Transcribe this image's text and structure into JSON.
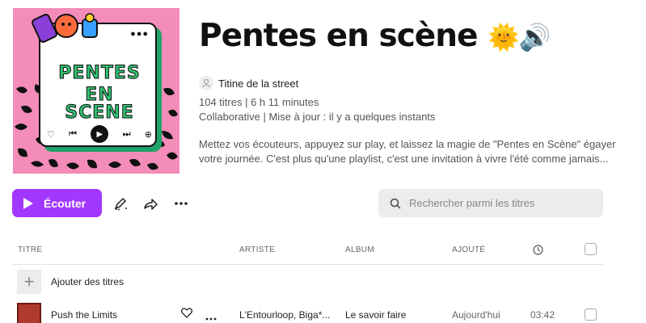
{
  "playlist": {
    "title": "Pentes en scène",
    "title_emoji": "🌞🔊",
    "owner": "Titine de la street",
    "stats": "104 titres | 6 h 11 minutes",
    "status": "Collaborative | Mise à jour : il y a quelques instants",
    "description": "Mettez vos écouteurs, appuyez sur play, et laissez la magie de \"Pentes en Scène\" égayer votre journée. C'est plus qu'une playlist, c'est une invitation à vivre l'été comme jamais..."
  },
  "cover": {
    "logo_line1": "PENTES",
    "logo_line2": "EN SCENE",
    "dots": "●●●"
  },
  "actions": {
    "play_label": "Écouter",
    "search_placeholder": "Rechercher parmi les titres"
  },
  "table": {
    "headers": {
      "title": "TITRE",
      "artist": "ARTISTE",
      "album": "ALBUM",
      "added": "AJOUTÉ"
    },
    "add_label": "Ajouter des titres",
    "rows": [
      {
        "title": "Push the Limits",
        "artist": "L'Entourloop, Biga*...",
        "album": "Le savoir faire",
        "added": "Aujourd'hui",
        "duration": "03:42"
      }
    ]
  },
  "colors": {
    "accent": "#a238ff",
    "cover_pink": "#f38cb8",
    "cover_green": "#2fbf6e"
  }
}
